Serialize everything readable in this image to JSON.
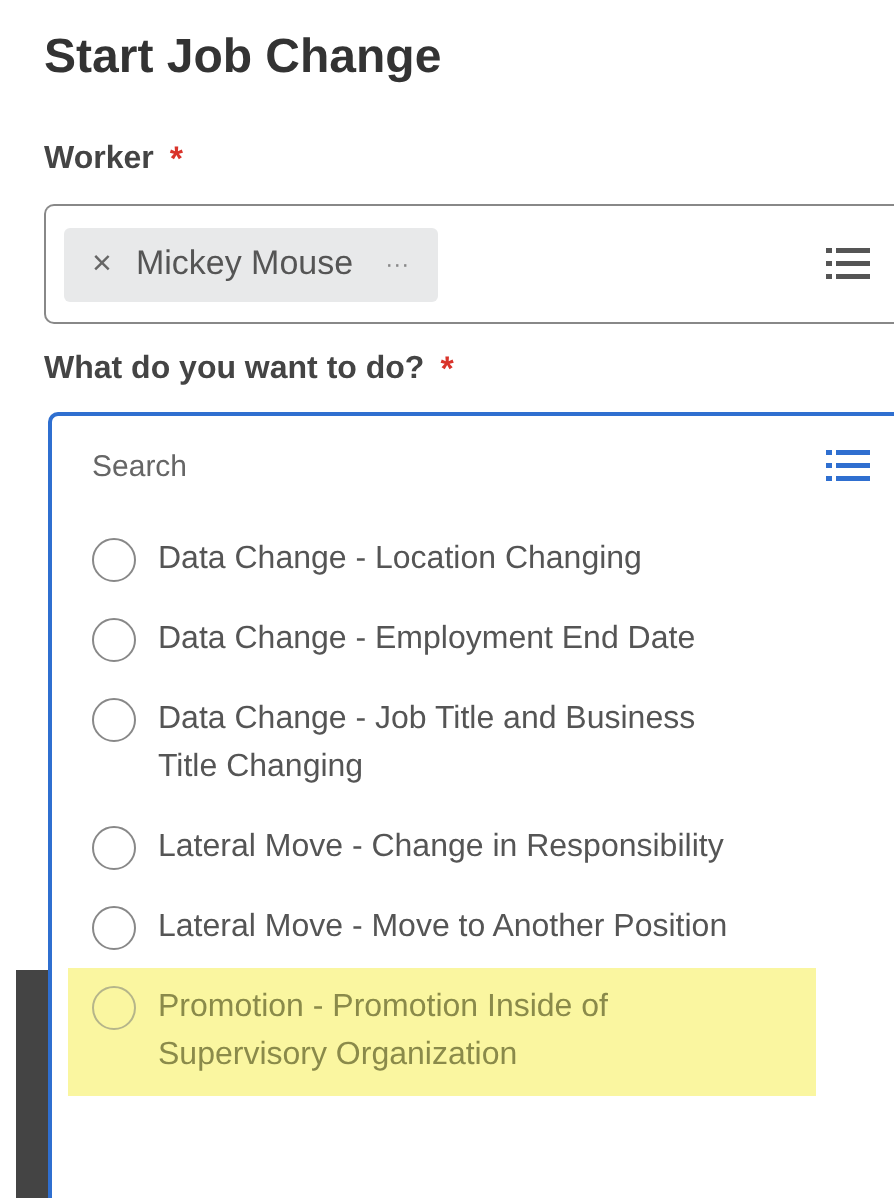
{
  "title": "Start Job Change",
  "worker": {
    "label": "Worker",
    "required_mark": "*",
    "chip": {
      "remove": "×",
      "name": "Mickey Mouse",
      "more": "···"
    }
  },
  "action": {
    "label": "What do you want to do?",
    "required_mark": "*",
    "search": {
      "placeholder": "Search"
    },
    "options": [
      {
        "label": "Data Change - Location Changing",
        "selected": false,
        "highlighted": false
      },
      {
        "label": "Data Change - Employment End Date",
        "selected": false,
        "highlighted": false
      },
      {
        "label": "Data Change - Job Title and Business Title Changing",
        "selected": false,
        "highlighted": false
      },
      {
        "label": "Lateral Move - Change in Responsibility",
        "selected": false,
        "highlighted": false
      },
      {
        "label": "Lateral Move - Move to Another Position",
        "selected": false,
        "highlighted": false
      },
      {
        "label": "Promotion - Promotion Inside of Supervisory Organization",
        "selected": false,
        "highlighted": true
      }
    ]
  }
}
